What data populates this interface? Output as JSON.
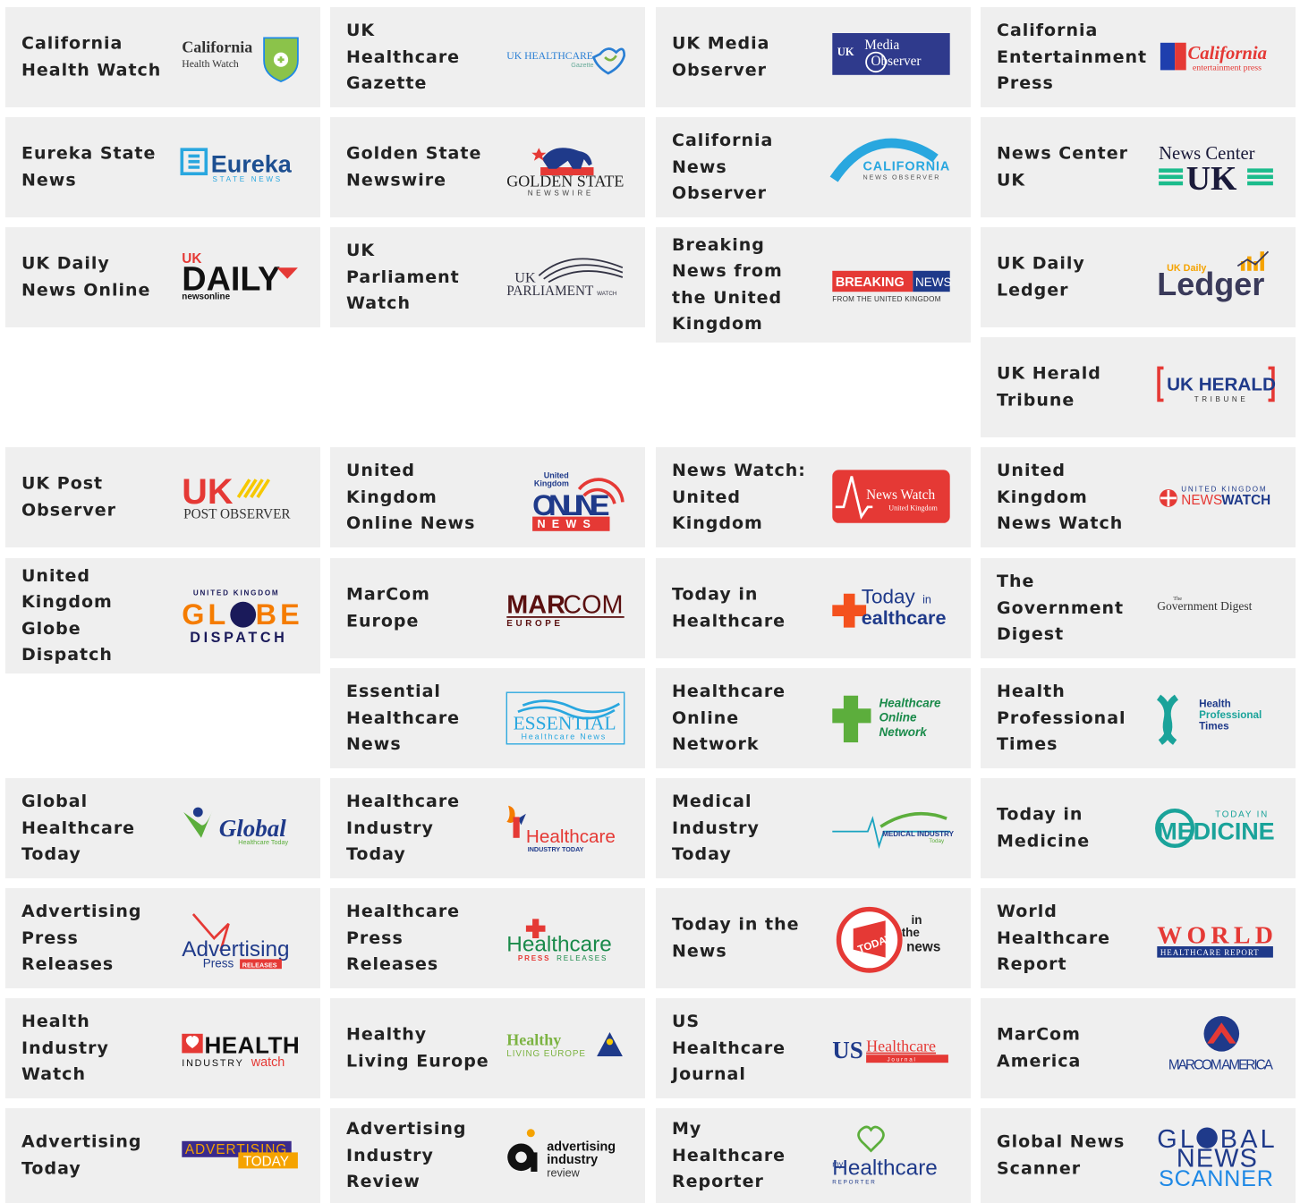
{
  "outlets": [
    {
      "name": "California Health Watch",
      "logo_text": [
        "California",
        "Health Watch"
      ]
    },
    {
      "name": "UK Healthcare Gazette",
      "logo_text": [
        "UK HEALTHCARE",
        "Gazette"
      ]
    },
    {
      "name": "UK Media Observer",
      "logo_text": [
        "UK",
        "Media",
        "Observer"
      ]
    },
    {
      "name": "California Entertainment Press",
      "logo_text": [
        "California",
        "entertainment press"
      ]
    },
    {
      "name": "Eureka State News",
      "logo_text": [
        "Eureka",
        "STATE NEWS"
      ]
    },
    {
      "name": "Golden State Newswire",
      "logo_text": [
        "GOLDEN STATE",
        "NEWSWIRE"
      ]
    },
    {
      "name": "California News Observer",
      "logo_text": [
        "CALIFORNIA",
        "NEWS OBSERVER"
      ]
    },
    {
      "name": "News Center UK",
      "logo_text": [
        "News Center",
        "UK"
      ]
    },
    {
      "name": "UK Daily News Online",
      "logo_text": [
        "UK",
        "DAILY",
        "newsonline"
      ]
    },
    {
      "name": "UK Parliament Watch",
      "logo_text": [
        "UK",
        "PARLIAMENT",
        "WATCH"
      ]
    },
    {
      "name": "Breaking News from the United Kingdom",
      "logo_text": [
        "BREAKING",
        "NEWS",
        "FROM THE UNITED KINGDOM"
      ]
    },
    {
      "name": "UK Daily Ledger",
      "logo_text": [
        "UK Daily",
        "Ledger"
      ]
    },
    {
      "name": "UK Herald Tribune",
      "logo_text": [
        "UK HERALD",
        "TRIBUNE"
      ]
    },
    {
      "name": "UK Post Observer",
      "logo_text": [
        "UK",
        "POST OBSERVER"
      ]
    },
    {
      "name": "United Kingdom Online News",
      "logo_text": [
        "United",
        "Kingdom",
        "ONLINE",
        "NEWS"
      ]
    },
    {
      "name": "News Watch: United Kingdom",
      "logo_text": [
        "News Watch",
        "United Kingdom"
      ]
    },
    {
      "name": "United Kingdom News Watch",
      "logo_text": [
        "UNITED KINGDOM",
        "NEWS",
        "WATCH"
      ]
    },
    {
      "name": "United Kingdom Globe Dispatch",
      "logo_text": [
        "UNITED KINGDOM",
        "GLOBE",
        "DISPATCH"
      ]
    },
    {
      "name": "MarCom Europe",
      "logo_text": [
        "MAR",
        "COM",
        "EUROPE"
      ]
    },
    {
      "name": "Today in Healthcare",
      "logo_text": [
        "Today",
        "in",
        "ealthcare"
      ]
    },
    {
      "name": "The Government Digest",
      "logo_text": [
        "The",
        "Government Digest"
      ]
    },
    {
      "name": "Essential Healthcare News",
      "logo_text": [
        "ESSENTIAL",
        "Healthcare News"
      ]
    },
    {
      "name": "Healthcare Online Network",
      "logo_text": [
        "Healthcare",
        "Online",
        "Network"
      ]
    },
    {
      "name": "Health Professional Times",
      "logo_text": [
        "Health",
        "Professional",
        "Times"
      ]
    },
    {
      "name": "Global Healthcare Today",
      "logo_text": [
        "Global",
        "Healthcare Today"
      ]
    },
    {
      "name": "Healthcare Industry Today",
      "logo_text": [
        "Healthcare",
        "INDUSTRY TODAY"
      ]
    },
    {
      "name": "Medical Industry Today",
      "logo_text": [
        "MEDICAL INDUSTRY",
        "Today"
      ]
    },
    {
      "name": "Today in Medicine",
      "logo_text": [
        "TODAY IN",
        "MEDICINE"
      ]
    },
    {
      "name": "Advertising Press Releases",
      "logo_text": [
        "Advertising",
        "Press",
        "RELEASES"
      ]
    },
    {
      "name": "Healthcare Press Releases",
      "logo_text": [
        "Healthcare",
        "PRESS",
        "RELEASES"
      ]
    },
    {
      "name": "Today in the News",
      "logo_text": [
        "TODAY",
        "in",
        "the",
        "news"
      ]
    },
    {
      "name": "World Healthcare Report",
      "logo_text": [
        "WORLD",
        "HEALTHCARE REPORT"
      ]
    },
    {
      "name": "Health Industry Watch",
      "logo_text": [
        "HEALTH",
        "INDUSTRY",
        "watch"
      ]
    },
    {
      "name": "Healthy Living Europe",
      "logo_text": [
        "Healthy",
        "LIVING EUROPE"
      ]
    },
    {
      "name": "US Healthcare Journal",
      "logo_text": [
        "US",
        "Healthcare",
        "Journal"
      ]
    },
    {
      "name": "MarCom America",
      "logo_text": [
        "MARCOM AMERICA"
      ]
    },
    {
      "name": "Advertising Today",
      "logo_text": [
        "ADVERTISING",
        "TODAY"
      ]
    },
    {
      "name": "Advertising Industry Review",
      "logo_text": [
        "advertising",
        "industry",
        "review"
      ]
    },
    {
      "name": "My Healthcare Reporter",
      "logo_text": [
        "my",
        "Healthcare",
        "REPORTER"
      ]
    },
    {
      "name": "Global News Scanner",
      "logo_text": [
        "GLOBAL",
        "NEWS",
        "SCANNER"
      ]
    }
  ]
}
